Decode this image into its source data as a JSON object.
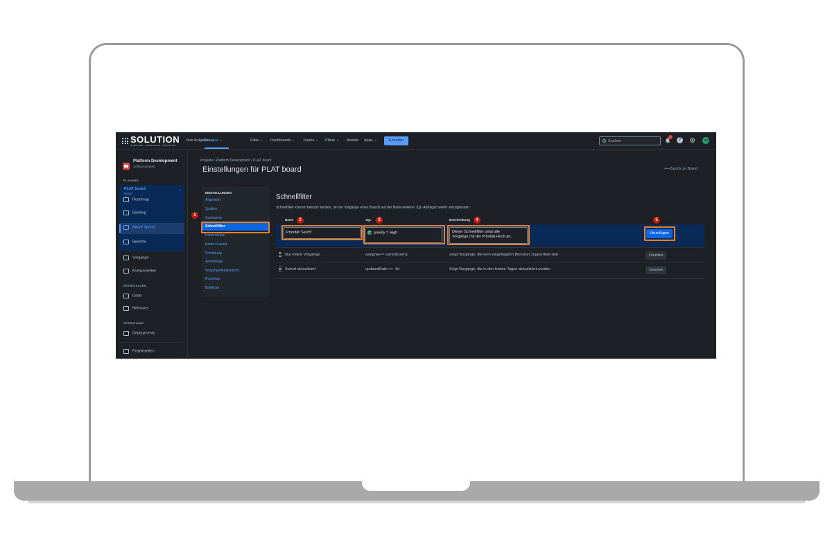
{
  "topnav": {
    "logo": "SOLUTION",
    "logo_tagline": "SOFTWARE · CONSULTING · SOLUTIONS",
    "items": [
      "Ihre Aufgaben ⌄",
      "Projekte ⌄",
      "Filter ⌄",
      "Dashboards ⌄",
      "Teams ⌄",
      "Pläne ⌄",
      "Assets",
      "Apps ⌄"
    ],
    "create_label": "Erstellen",
    "search_placeholder": "Suchen",
    "notifications_count": "1",
    "help_label": "?",
    "avatar_initials": "CS"
  },
  "sidebar": {
    "project_name": "Platform Development",
    "project_type": "Softwareprojekt",
    "section_planning": "PLANUNG",
    "board_title": "PLAT board",
    "board_subtitle": "Board",
    "items": [
      {
        "label": "Roadmap",
        "icon": "roadmap-icon"
      },
      {
        "label": "Backlog",
        "icon": "backlog-icon"
      },
      {
        "label": "Aktive Sprints",
        "icon": "board-icon"
      },
      {
        "label": "Berichte",
        "icon": "chart-icon"
      },
      {
        "label": "Vorgänge",
        "icon": "issues-icon"
      },
      {
        "label": "Komponenten",
        "icon": "components-icon"
      }
    ],
    "section_development": "ENTWICKLUNG",
    "dev_items": [
      {
        "label": "Code",
        "icon": "code-icon"
      },
      {
        "label": "Releases",
        "icon": "ship-icon"
      }
    ],
    "section_operations": "OPERATIONS",
    "ops_items": [
      {
        "label": "Deployments",
        "icon": "cloud-icon"
      }
    ],
    "footer_item": "Projektseiten"
  },
  "header": {
    "breadcrumb": "Projekte  /  Platform Development  /  PLAT board",
    "title": "Einstellungen für PLAT board",
    "back_link": "⟵Zurück zu Board"
  },
  "settings_nav": {
    "heading": "EINSTELLUNGEN",
    "items": [
      "Allgemein",
      "Spalten",
      "Swimlanes",
      "Schnellfilter",
      "Kartenfarben",
      "Karten-Layout",
      "Schätzung",
      "Arbeitstage",
      "Vorgangsdetailansicht",
      "Roadmap",
      "Einblicke"
    ],
    "active_index": 3
  },
  "content": {
    "title": "Schnellfilter",
    "description": "Schnellfilter können benutzt werden, um die Vorgänge eines Boards auf der Basis weiterer JQL-Abfragen weiter einzugrenzen.",
    "columns": {
      "name": "Name",
      "jql": "JQL",
      "description": "Beschreibung"
    },
    "new_filter": {
      "name": "Priorität \"Hoch\"",
      "jql": "priority = High",
      "description_line1": "Dieser Schnellfilter zeigt alle",
      "description_line2": "Vorgänge mit der Priorität Hoch an.",
      "add_label": "Hinzufügen"
    },
    "rows": [
      {
        "name": "Nur meine Vorgänge",
        "jql": "assignee = currentUser()",
        "description": "Zeigt Vorgänge, die dem eingeloggten Benutzer zugeordnet sind",
        "action": "Löschen"
      },
      {
        "name": "Zuletzt aktualisiert",
        "jql": "updatedDate >= -1d",
        "description": "Zeigt Vorgänge, die in den letzten Tagen aktualisiert wurden",
        "action": "Löschen"
      }
    ]
  },
  "annotations": {
    "markers": [
      "1",
      "2",
      "3",
      "4",
      "5"
    ],
    "highlight_color": "#f07f1e",
    "marker_color": "#c9190b"
  },
  "colors": {
    "background": "#1d2125",
    "accent": "#579dff",
    "selected_row": "#092957"
  }
}
